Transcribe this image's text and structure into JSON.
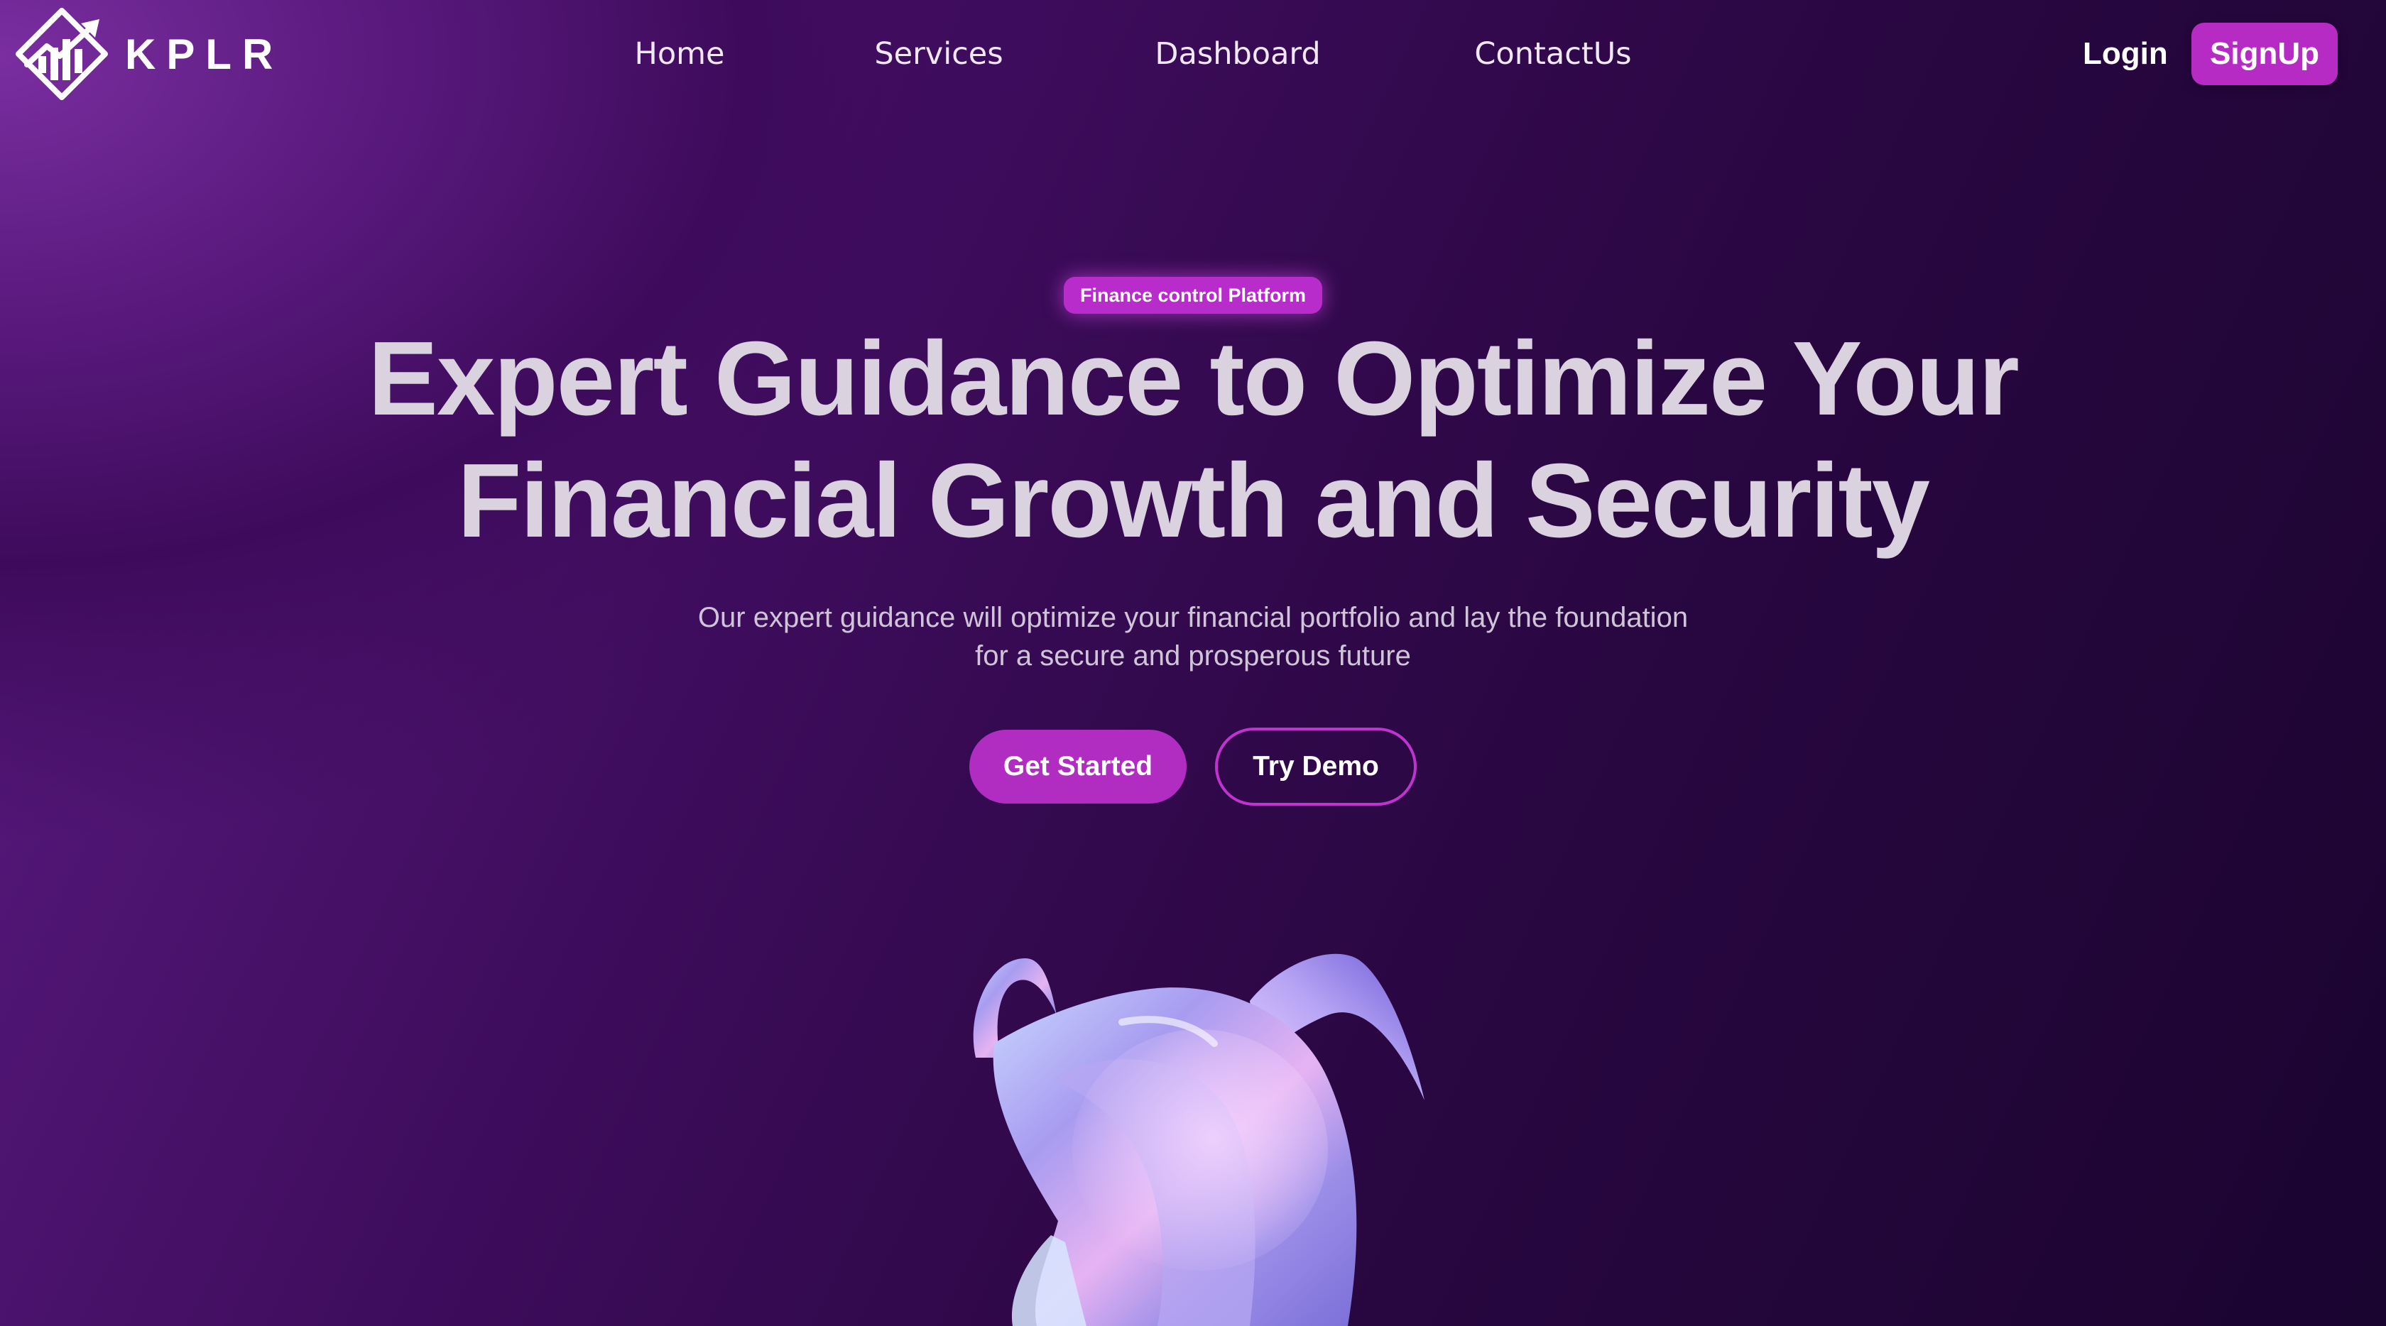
{
  "brand": {
    "name": "KPLR",
    "logo_icon": "diamond-chart-arrow-icon"
  },
  "nav": {
    "links": [
      "Home",
      "Services",
      "Dashboard",
      "ContactUs"
    ]
  },
  "auth": {
    "login_label": "Login",
    "signup_label": "SignUp"
  },
  "hero": {
    "badge": "Finance control Platform",
    "headline_line1": "Expert Guidance to Optimize Your",
    "headline_line2": "Financial Growth and Security",
    "subtitle_line1": "Our expert guidance will optimize your financial portfolio and lay the foundation",
    "subtitle_line2": "for a secure and prosperous future",
    "cta_primary": "Get Started",
    "cta_secondary": "Try Demo",
    "art": "iridescent-3d-shape"
  },
  "colors": {
    "accent": "#b52bc4",
    "background_dark": "#1a0430",
    "background_light": "#7a2ea0",
    "headline": "#dad2df"
  }
}
